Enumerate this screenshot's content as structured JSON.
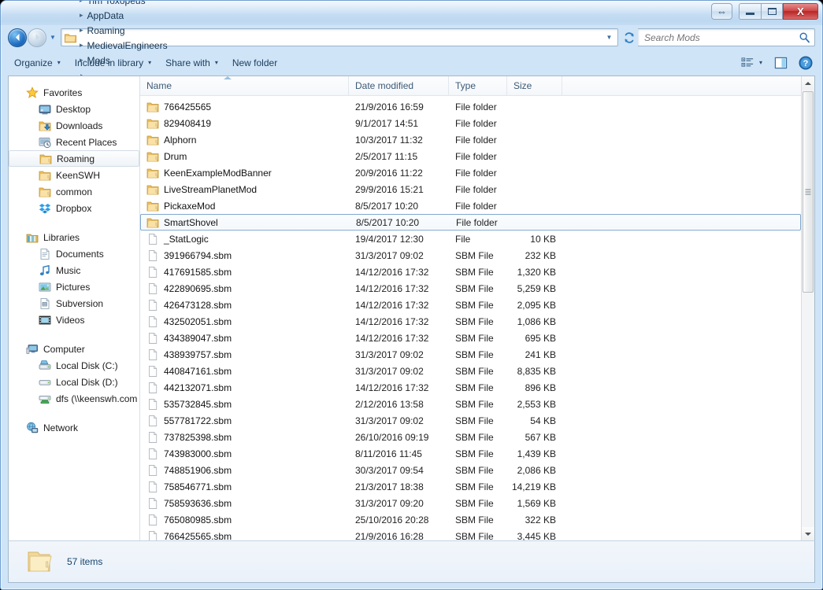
{
  "window": {
    "title": "",
    "controls": {
      "help_label": "⇔",
      "minimize_label": "",
      "maximize_label": "",
      "close_label": "X"
    }
  },
  "addressbar": {
    "back_icon": "back-arrow-icon",
    "forward_icon": "forward-arrow-icon",
    "history_icon": "chevron-down-icon",
    "folder_icon": "folder-icon",
    "crumbs": [
      {
        "label": "Tim Toxopeus"
      },
      {
        "label": "AppData"
      },
      {
        "label": "Roaming"
      },
      {
        "label": "MedievalEngineers"
      },
      {
        "label": "Mods"
      }
    ],
    "separator": "▸",
    "dropdown_icon": "chevron-down-icon",
    "refresh_icon": "refresh-icon"
  },
  "search": {
    "placeholder": "Search Mods",
    "value": "",
    "icon": "search-icon"
  },
  "toolbar": {
    "items": [
      {
        "label": "Organize",
        "has_caret": true
      },
      {
        "label": "Include in library",
        "has_caret": true
      },
      {
        "label": "Share with",
        "has_caret": true
      },
      {
        "label": "New folder",
        "has_caret": false
      }
    ],
    "caret": "▾",
    "view_icon": "view-list-icon",
    "view_caret": "▾",
    "preview_pane_icon": "preview-pane-icon",
    "help_icon": "help-circle-icon"
  },
  "sidebar": {
    "groups": [
      {
        "root": {
          "label": "Favorites",
          "icon": "star-icon"
        },
        "items": [
          {
            "label": "Desktop",
            "icon": "desktop-icon",
            "selected": false
          },
          {
            "label": "Downloads",
            "icon": "downloads-folder-icon",
            "selected": false
          },
          {
            "label": "Recent Places",
            "icon": "recent-places-icon",
            "selected": false
          },
          {
            "label": "Roaming",
            "icon": "folder-icon",
            "selected": true
          },
          {
            "label": "KeenSWH",
            "icon": "folder-icon",
            "selected": false
          },
          {
            "label": "common",
            "icon": "folder-icon",
            "selected": false
          },
          {
            "label": "Dropbox",
            "icon": "dropbox-icon",
            "selected": false
          }
        ]
      },
      {
        "root": {
          "label": "Libraries",
          "icon": "libraries-icon"
        },
        "items": [
          {
            "label": "Documents",
            "icon": "documents-icon",
            "selected": false
          },
          {
            "label": "Music",
            "icon": "music-icon",
            "selected": false
          },
          {
            "label": "Pictures",
            "icon": "pictures-icon",
            "selected": false
          },
          {
            "label": "Subversion",
            "icon": "subversion-icon",
            "selected": false
          },
          {
            "label": "Videos",
            "icon": "videos-icon",
            "selected": false
          }
        ]
      },
      {
        "root": {
          "label": "Computer",
          "icon": "computer-icon"
        },
        "items": [
          {
            "label": "Local Disk (C:)",
            "icon": "system-drive-icon",
            "selected": false
          },
          {
            "label": "Local Disk (D:)",
            "icon": "drive-icon",
            "selected": false
          },
          {
            "label": "dfs (\\\\keenswh.com",
            "icon": "network-drive-icon",
            "selected": false
          }
        ]
      },
      {
        "root": {
          "label": "Network",
          "icon": "network-icon"
        },
        "items": []
      }
    ]
  },
  "filelist": {
    "columns": [
      {
        "label": "Name"
      },
      {
        "label": "Date modified"
      },
      {
        "label": "Type"
      },
      {
        "label": "Size"
      }
    ],
    "sort_column": "Name",
    "sort_direction": "ascending",
    "rows": [
      {
        "name": "766425565",
        "date": "21/9/2016 16:59",
        "type": "File folder",
        "size": "",
        "icon": "folder-icon",
        "selected": false
      },
      {
        "name": "829408419",
        "date": "9/1/2017 14:51",
        "type": "File folder",
        "size": "",
        "icon": "folder-icon",
        "selected": false
      },
      {
        "name": "Alphorn",
        "date": "10/3/2017 11:32",
        "type": "File folder",
        "size": "",
        "icon": "folder-icon",
        "selected": false
      },
      {
        "name": "Drum",
        "date": "2/5/2017 11:15",
        "type": "File folder",
        "size": "",
        "icon": "folder-icon",
        "selected": false
      },
      {
        "name": "KeenExampleModBanner",
        "date": "20/9/2016 11:22",
        "type": "File folder",
        "size": "",
        "icon": "folder-icon",
        "selected": false
      },
      {
        "name": "LiveStreamPlanetMod",
        "date": "29/9/2016 15:21",
        "type": "File folder",
        "size": "",
        "icon": "folder-icon",
        "selected": false
      },
      {
        "name": "PickaxeMod",
        "date": "8/5/2017 10:20",
        "type": "File folder",
        "size": "",
        "icon": "folder-icon",
        "selected": false
      },
      {
        "name": "SmartShovel",
        "date": "8/5/2017 10:20",
        "type": "File folder",
        "size": "",
        "icon": "folder-icon",
        "selected": true
      },
      {
        "name": "_StatLogic",
        "date": "19/4/2017 12:30",
        "type": "File",
        "size": "10 KB",
        "icon": "file-icon",
        "selected": false
      },
      {
        "name": "391966794.sbm",
        "date": "31/3/2017 09:02",
        "type": "SBM File",
        "size": "232 KB",
        "icon": "file-icon",
        "selected": false
      },
      {
        "name": "417691585.sbm",
        "date": "14/12/2016 17:32",
        "type": "SBM File",
        "size": "1,320 KB",
        "icon": "file-icon",
        "selected": false
      },
      {
        "name": "422890695.sbm",
        "date": "14/12/2016 17:32",
        "type": "SBM File",
        "size": "5,259 KB",
        "icon": "file-icon",
        "selected": false
      },
      {
        "name": "426473128.sbm",
        "date": "14/12/2016 17:32",
        "type": "SBM File",
        "size": "2,095 KB",
        "icon": "file-icon",
        "selected": false
      },
      {
        "name": "432502051.sbm",
        "date": "14/12/2016 17:32",
        "type": "SBM File",
        "size": "1,086 KB",
        "icon": "file-icon",
        "selected": false
      },
      {
        "name": "434389047.sbm",
        "date": "14/12/2016 17:32",
        "type": "SBM File",
        "size": "695 KB",
        "icon": "file-icon",
        "selected": false
      },
      {
        "name": "438939757.sbm",
        "date": "31/3/2017 09:02",
        "type": "SBM File",
        "size": "241 KB",
        "icon": "file-icon",
        "selected": false
      },
      {
        "name": "440847161.sbm",
        "date": "31/3/2017 09:02",
        "type": "SBM File",
        "size": "8,835 KB",
        "icon": "file-icon",
        "selected": false
      },
      {
        "name": "442132071.sbm",
        "date": "14/12/2016 17:32",
        "type": "SBM File",
        "size": "896 KB",
        "icon": "file-icon",
        "selected": false
      },
      {
        "name": "535732845.sbm",
        "date": "2/12/2016 13:58",
        "type": "SBM File",
        "size": "2,553 KB",
        "icon": "file-icon",
        "selected": false
      },
      {
        "name": "557781722.sbm",
        "date": "31/3/2017 09:02",
        "type": "SBM File",
        "size": "54 KB",
        "icon": "file-icon",
        "selected": false
      },
      {
        "name": "737825398.sbm",
        "date": "26/10/2016 09:19",
        "type": "SBM File",
        "size": "567 KB",
        "icon": "file-icon",
        "selected": false
      },
      {
        "name": "743983000.sbm",
        "date": "8/11/2016 11:45",
        "type": "SBM File",
        "size": "1,439 KB",
        "icon": "file-icon",
        "selected": false
      },
      {
        "name": "748851906.sbm",
        "date": "30/3/2017 09:54",
        "type": "SBM File",
        "size": "2,086 KB",
        "icon": "file-icon",
        "selected": false
      },
      {
        "name": "758546771.sbm",
        "date": "21/3/2017 18:38",
        "type": "SBM File",
        "size": "14,219 KB",
        "icon": "file-icon",
        "selected": false
      },
      {
        "name": "758593636.sbm",
        "date": "31/3/2017 09:20",
        "type": "SBM File",
        "size": "1,569 KB",
        "icon": "file-icon",
        "selected": false
      },
      {
        "name": "765080985.sbm",
        "date": "25/10/2016 20:28",
        "type": "SBM File",
        "size": "322 KB",
        "icon": "file-icon",
        "selected": false
      },
      {
        "name": "766425565.sbm",
        "date": "21/9/2016 16:28",
        "type": "SBM File",
        "size": "3,445 KB",
        "icon": "file-icon",
        "selected": false
      }
    ]
  },
  "scrollbar": {
    "up_icon": "scroll-up-icon",
    "down_icon": "scroll-down-icon",
    "thumb_position_percent": 0
  },
  "statusbar": {
    "icon": "folder-icon",
    "text": "57 items"
  },
  "colors": {
    "accent": "#1f6fc4",
    "close_button": "#b92525",
    "selection_border": "#7fa8cf",
    "folder_yellow": "#f5c963",
    "window_border": "#6f9fd0"
  }
}
